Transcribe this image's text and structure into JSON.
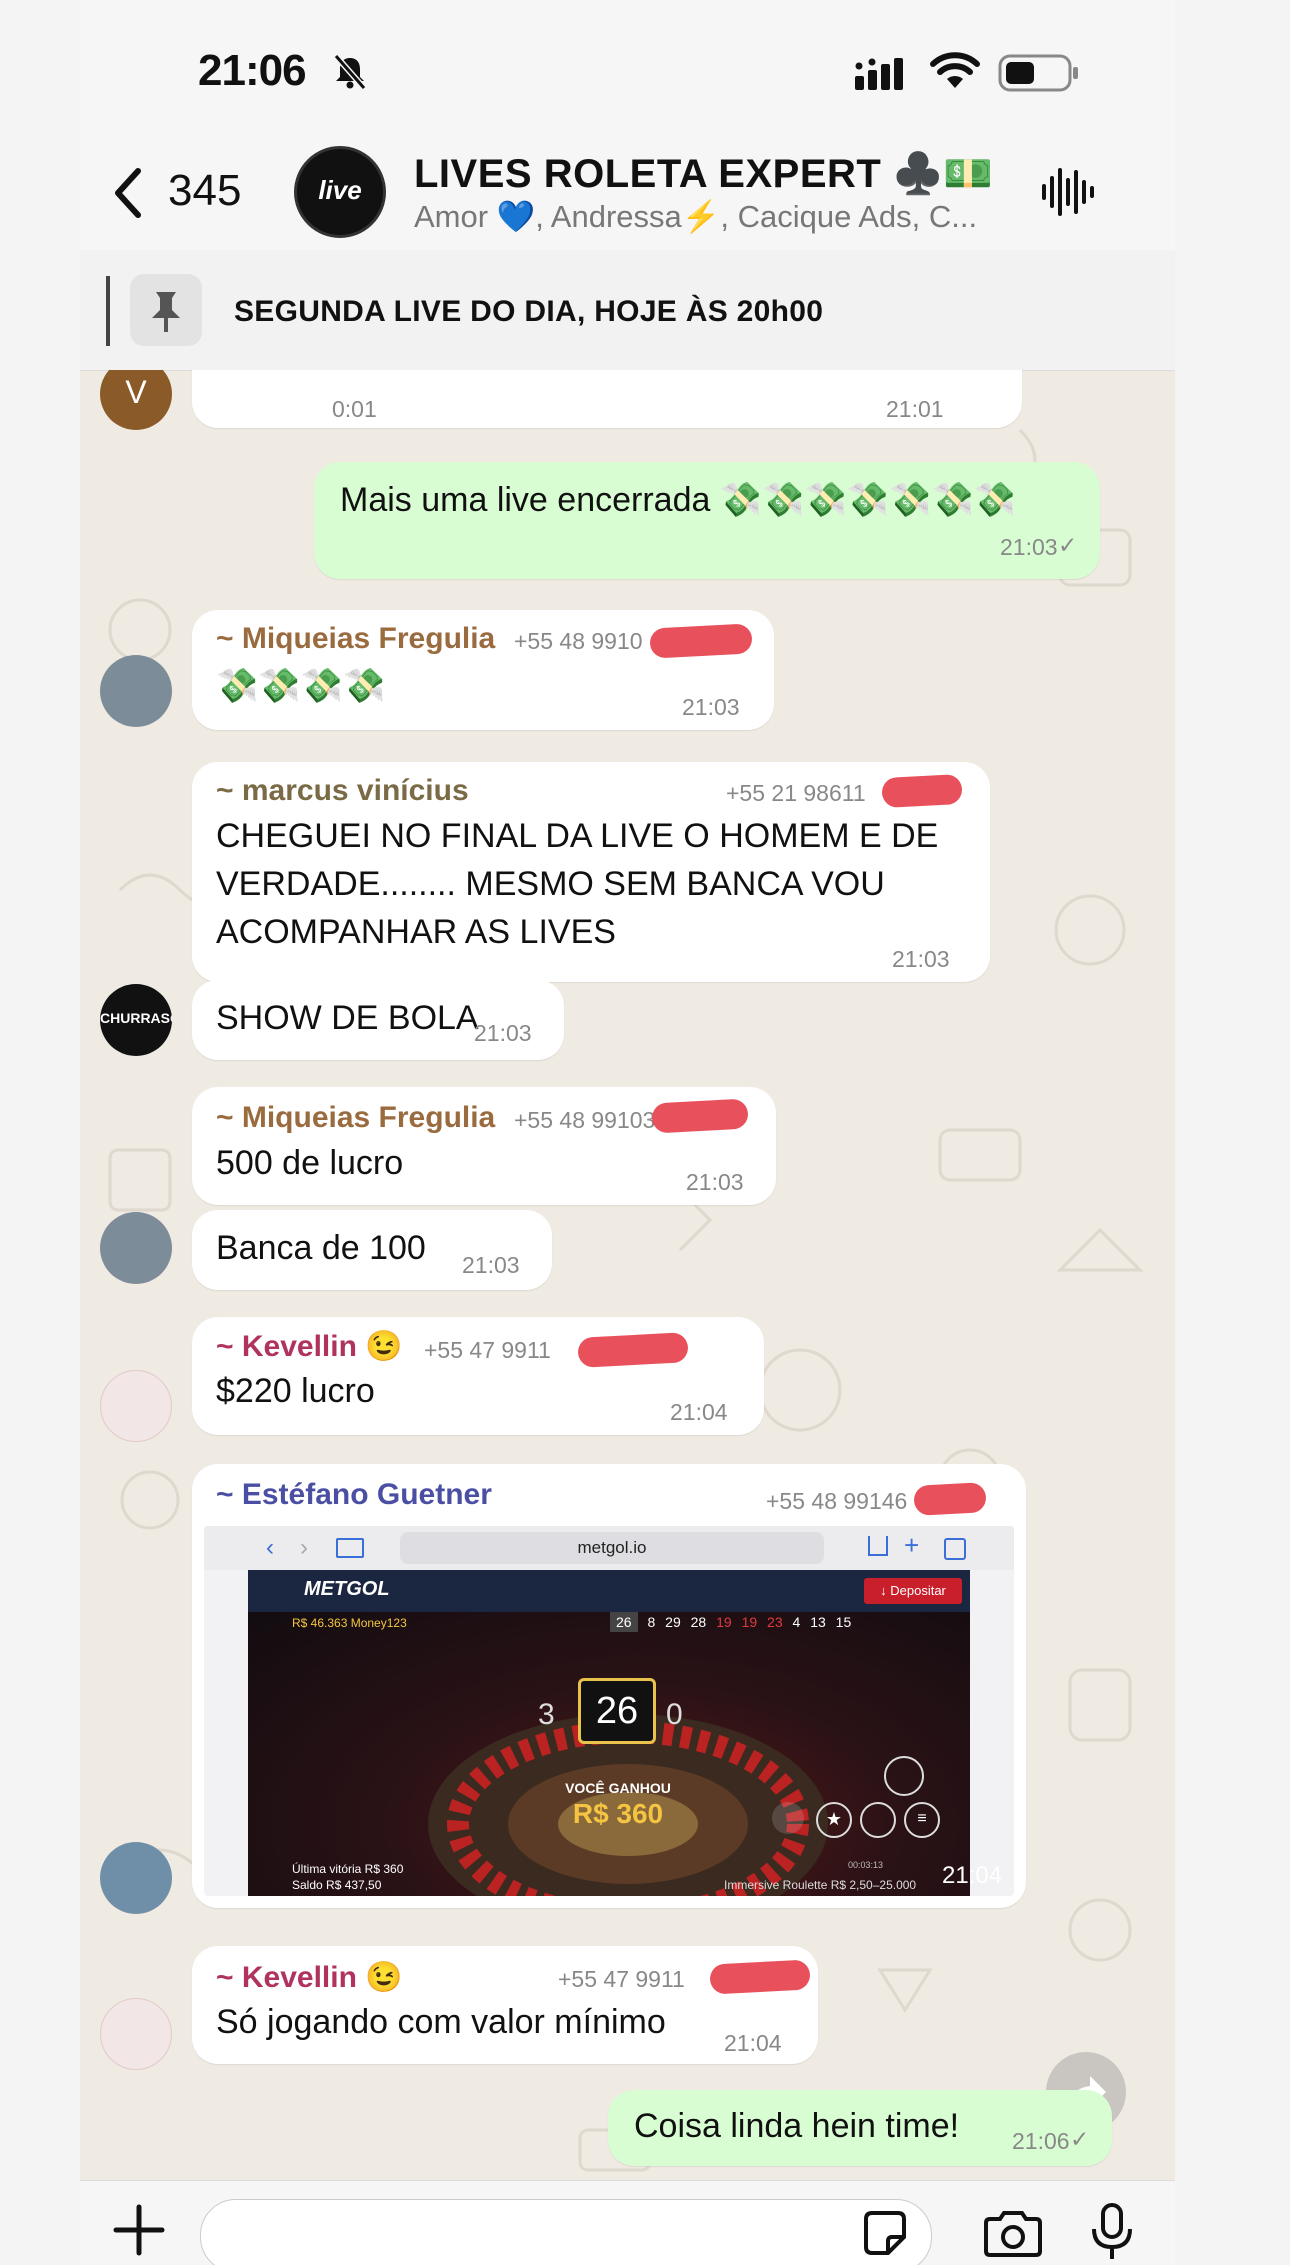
{
  "status": {
    "time": "21:06"
  },
  "header": {
    "back_count": "345",
    "avatar_text": "live",
    "title": "LIVES ROLETA EXPERT ♣️💵",
    "members": "Amor 💙, Andressa⚡, Cacique Ads, C..."
  },
  "pinned": {
    "text": "SEGUNDA LIVE DO DIA, HOJE ÀS 20h00"
  },
  "messages": {
    "m0": {
      "avatar_letter": "V",
      "duration": "0:01",
      "time": "21:01"
    },
    "m1": {
      "text": "Mais uma live encerrada 💸💸💸💸💸💸💸",
      "time": "21:03",
      "status": "✓"
    },
    "m2": {
      "sender": "~ Miqueias Fregulia",
      "phone": "+55 48 9910",
      "text": "💸💸💸💸",
      "time": "21:03"
    },
    "m3": {
      "sender": "~ marcus vinícius",
      "phone": "+55 21 98611",
      "lines": [
        "CHEGUEI NO FINAL DA LIVE O HOMEM E DE",
        "VERDADE........ MESMO SEM BANCA VOU",
        "ACOMPANHAR AS LIVES"
      ],
      "time": "21:03"
    },
    "m4": {
      "avatar_text": "CHURRASC",
      "text": "SHOW DE BOLA",
      "time": "21:03"
    },
    "m5": {
      "sender": "~ Miqueias Fregulia",
      "phone": "+55 48 99103",
      "text": "500 de lucro",
      "time": "21:03"
    },
    "m6": {
      "text": "Banca de 100",
      "time": "21:03"
    },
    "m7": {
      "sender": "~ Kevellin 😉",
      "phone": "+55 47 9911",
      "text": "$220 lucro",
      "time": "21:04"
    },
    "m8": {
      "sender": "~ Estéfano Guetner",
      "phone": "+55 48 99146",
      "time": "21:04",
      "browser_url": "metgol.io",
      "site_logo": "METGOL",
      "deposit": "↓ Depositar",
      "balance_top": "R$ 46.363 Money123",
      "numbers": [
        "26",
        "8",
        "29",
        "28",
        "19",
        "19",
        "23",
        "4",
        "13",
        "15"
      ],
      "winning_number": "26",
      "left_number": "3",
      "right_number": "0",
      "win_label": "VOCÊ GANHOU",
      "win_amount": "R$ 360",
      "last_win": "Última vitória R$ 360",
      "balance": "Saldo R$ 437,50",
      "game": "Immersive Roulette R$ 2,50–25.000",
      "clock": "00:03:13"
    },
    "m9": {
      "sender": "~ Kevellin 😉",
      "phone": "+55 47 9911",
      "text": "Só jogando com valor mínimo",
      "time": "21:04"
    },
    "m10": {
      "text": "Coisa linda hein time!",
      "time": "21:06",
      "status": "✓"
    }
  },
  "colors": {
    "miqueias": "#9a6b3f",
    "marcus": "#7a6a45",
    "kevellin": "#b0335f",
    "estefano": "#4b4fa3",
    "outgoing": "#d9fdd3",
    "wallpaper": "#efeae2"
  },
  "icons": [
    "bell-slash-icon",
    "signal-icon",
    "wifi-icon",
    "battery-icon",
    "back-chevron-icon",
    "voice-waveform-icon",
    "pin-icon",
    "plus-icon",
    "sticker-icon",
    "camera-icon",
    "microphone-icon",
    "forward-icon"
  ]
}
